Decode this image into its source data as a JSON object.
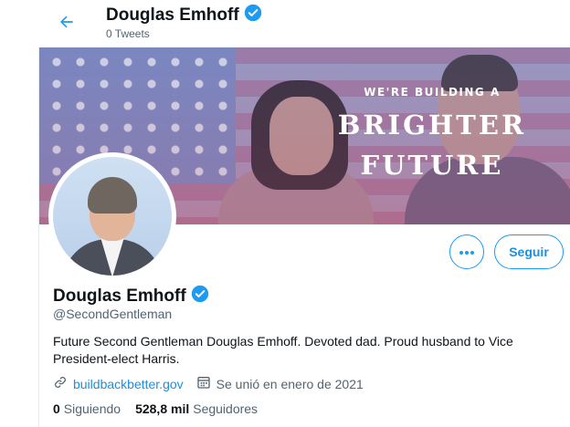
{
  "header": {
    "name": "Douglas Emhoff",
    "tweets": "0 Tweets"
  },
  "banner": {
    "line_small": "WE'RE BUILDING A",
    "line_big_1": "BRIGHTER",
    "line_big_2": "FUTURE"
  },
  "actions": {
    "follow_label": "Seguir"
  },
  "profile": {
    "name": "Douglas Emhoff",
    "handle": "@SecondGentleman",
    "bio": "Future Second Gentleman Douglas Emhoff. Devoted dad. Proud husband to Vice President-elect Harris.",
    "website": "buildbackbetter.gov",
    "joined": "Se unió en enero de 2021"
  },
  "stats": {
    "following_count": "0",
    "following_label": "Siguiendo",
    "followers_count": "528,8 mil",
    "followers_label": "Seguidores"
  },
  "colors": {
    "accent": "#1d9bf0",
    "verified": "#1d9bf0",
    "muted": "#536471"
  }
}
